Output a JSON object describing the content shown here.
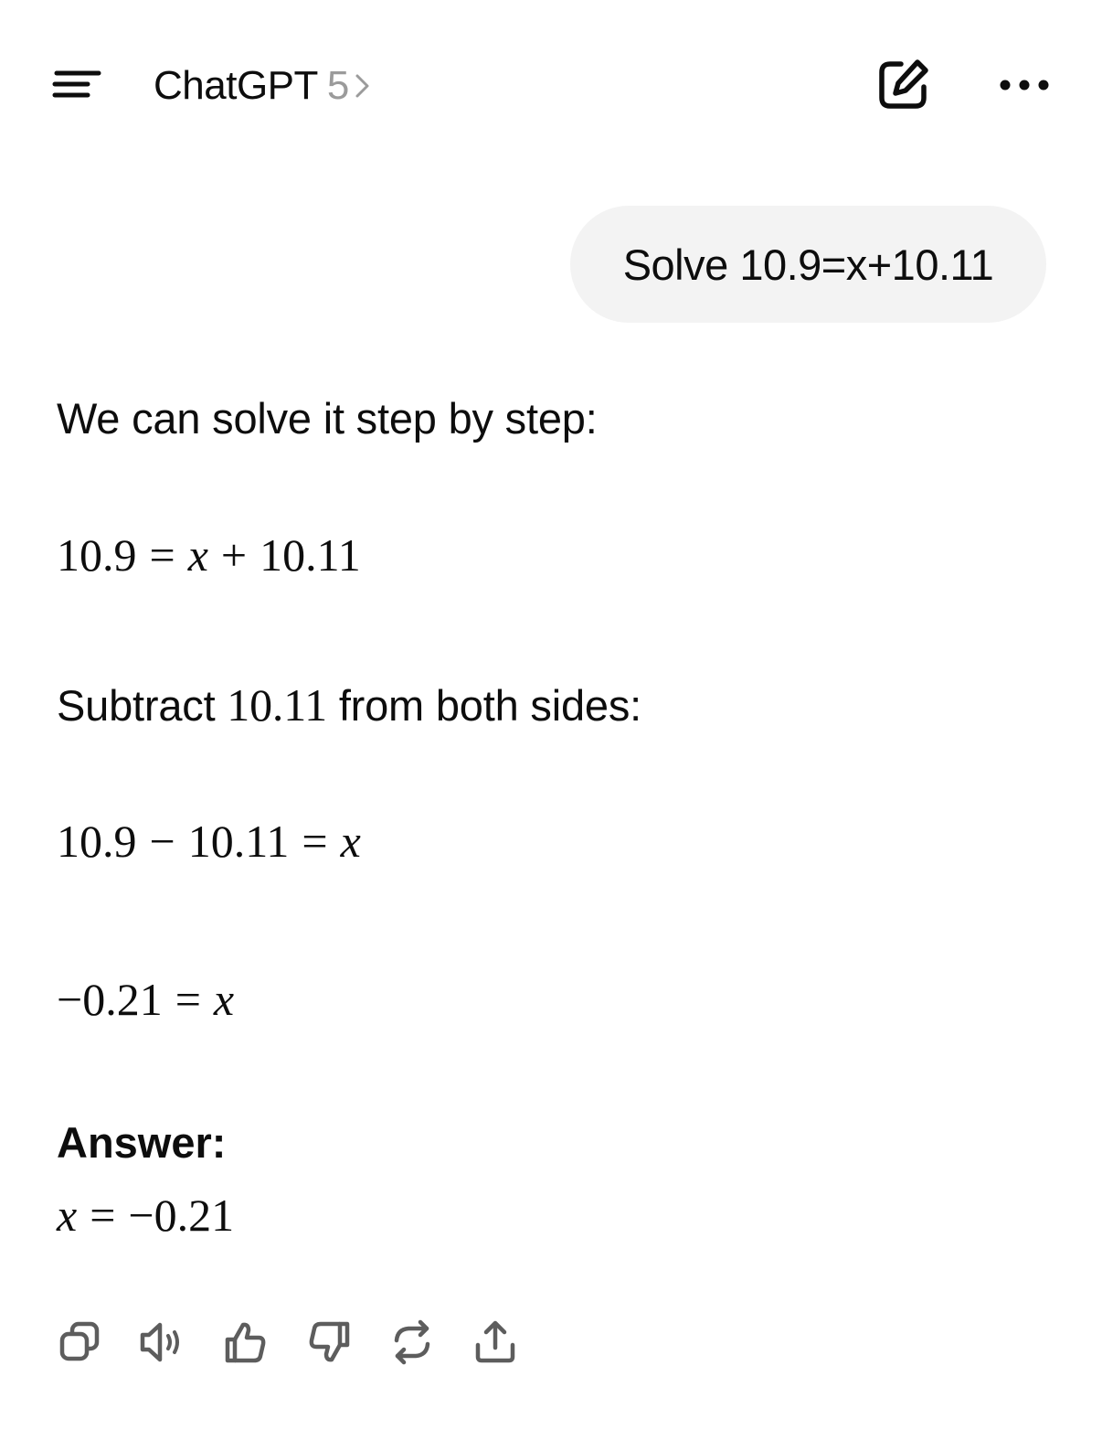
{
  "header": {
    "title": "ChatGPT",
    "version": "5",
    "menu_icon": "sidebar-menu-icon",
    "new_chat_icon": "new-chat-edit-icon",
    "more_icon": "more-options-icon"
  },
  "conversation": {
    "user_message": "Solve 10.9=x+10.11",
    "assistant": {
      "intro": "We can solve it step by step:",
      "eq1": {
        "lhs": "10.9",
        "op": "=",
        "var": "x",
        "plus": "+",
        "rhs": "10.11"
      },
      "subtract_before": "Subtract",
      "subtract_value": "10.11",
      "subtract_after": "from both sides:",
      "eq2": {
        "a": "10.9",
        "minus": "−",
        "b": "10.11",
        "eq": "=",
        "var": "x"
      },
      "eq3": {
        "val": "−0.21",
        "eq": "=",
        "var": "x"
      },
      "answer_label": "Answer:",
      "eq4": {
        "var": "x",
        "eq": "=",
        "val": "−0.21"
      }
    }
  },
  "actions": [
    "copy-icon",
    "read-aloud-icon",
    "thumbs-up-icon",
    "thumbs-down-icon",
    "regenerate-icon",
    "share-icon"
  ],
  "colors": {
    "text": "#0d0d0d",
    "muted": "#9b9b9b",
    "bubble": "#f3f3f3",
    "icon": "#5d5d5d"
  }
}
